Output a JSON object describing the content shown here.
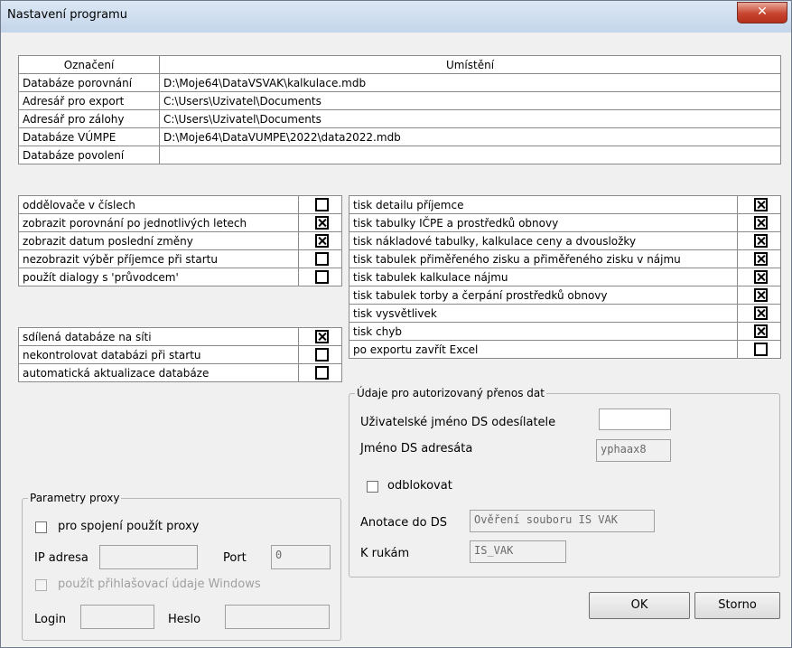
{
  "window": {
    "title": "Nastavení programu",
    "close_icon": "close-icon"
  },
  "paths": {
    "header": {
      "label": "Označení",
      "location": "Umístění"
    },
    "rows": [
      {
        "label": "Databáze porovnání",
        "value": "D:\\Moje64\\DataVSVAK\\kalkulace.mdb"
      },
      {
        "label": "Adresář pro export",
        "value": "C:\\Users\\Uzivatel\\Documents"
      },
      {
        "label": "Adresář pro zálohy",
        "value": "C:\\Users\\Uzivatel\\Documents"
      },
      {
        "label": "Databáze VÚMPE",
        "value": "D:\\Moje64\\DataVUMPE\\2022\\data2022.mdb"
      },
      {
        "label": "Databáze povolení",
        "value": ""
      }
    ]
  },
  "options_left": [
    {
      "label": "oddělovače v číslech",
      "checked": false
    },
    {
      "label": "zobrazit porovnání po jednotlivých letech",
      "checked": true
    },
    {
      "label": "zobrazit datum poslední změny",
      "checked": true
    },
    {
      "label": "nezobrazit výběr příjemce při startu",
      "checked": false
    },
    {
      "label": "použít dialogy s 'průvodcem'",
      "checked": false
    }
  ],
  "options_db": [
    {
      "label": "sdílená databáze na síti",
      "checked": true
    },
    {
      "label": "nekontrolovat databázi při startu",
      "checked": false
    },
    {
      "label": "automatická aktualizace databáze",
      "checked": false
    }
  ],
  "options_print": [
    {
      "label": "tisk detailu příjemce",
      "checked": true
    },
    {
      "label": "tisk tabulky IČPE a prostředků obnovy",
      "checked": true
    },
    {
      "label": "tisk nákladové tabulky, kalkulace ceny a dvousložky",
      "checked": true
    },
    {
      "label": "tisk tabulek přiměřeného zisku a přiměřeného zisku v nájmu",
      "checked": true
    },
    {
      "label": "tisk tabulek kalkulace nájmu",
      "checked": true
    },
    {
      "label": "tisk tabulek torby a čerpání prostředků obnovy",
      "checked": true
    },
    {
      "label": "tisk vysvětlivek",
      "checked": true
    },
    {
      "label": "tisk chyb",
      "checked": true
    },
    {
      "label": "po exportu zavřít Excel",
      "checked": false
    }
  ],
  "transfer": {
    "legend": "Údaje pro autorizovaný přenos dat",
    "sender_label": "Uživatelské jméno DS odesílatele",
    "sender_value": "",
    "recipient_label": "Jméno DS adresáta",
    "recipient_value": "yphaax8",
    "unlock_label": "odblokovat",
    "unlock_checked": false,
    "annotation_label": "Anotace do DS",
    "annotation_value": "Ověření souboru IS VAK",
    "attention_label": "K rukám",
    "attention_value": "IS_VAK"
  },
  "proxy": {
    "legend": "Parametry proxy",
    "use_proxy_label": "pro spojení použít proxy",
    "use_proxy_checked": false,
    "ip_label": "IP adresa",
    "ip_value": "",
    "port_label": "Port",
    "port_value": "0",
    "windows_creds_label": "použít přihlašovací údaje Windows",
    "login_label": "Login",
    "login_value": "",
    "password_label": "Heslo",
    "password_value": ""
  },
  "buttons": {
    "ok": "OK",
    "cancel": "Storno"
  }
}
